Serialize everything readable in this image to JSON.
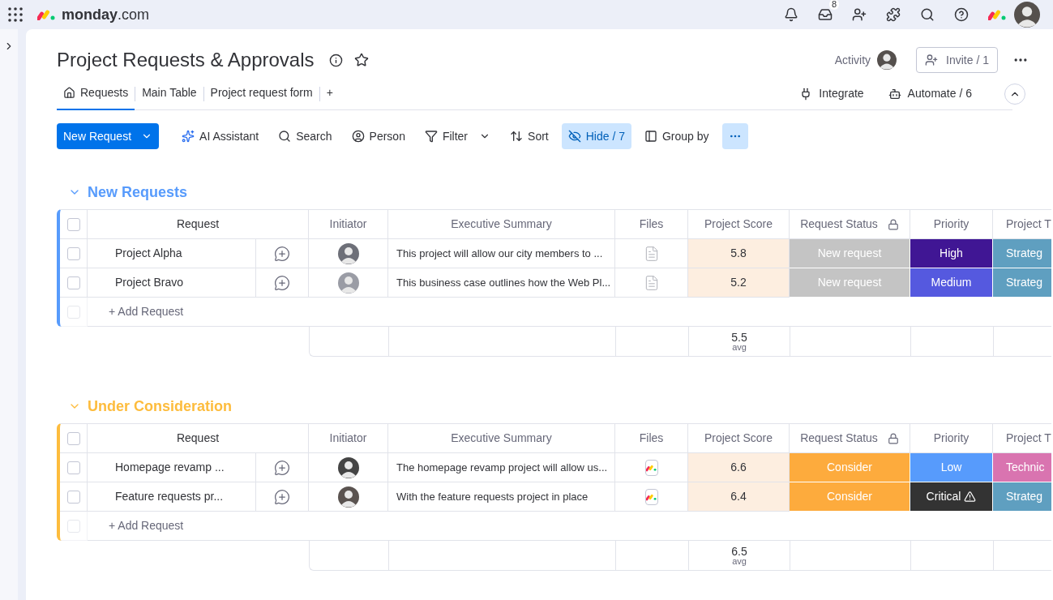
{
  "top_bar": {
    "brand": "monday",
    "brand_suffix": ".com",
    "inbox_badge": "8"
  },
  "board": {
    "title": "Project Requests & Approvals",
    "activity_label": "Activity",
    "invite_label": "Invite / 1"
  },
  "tabs": [
    {
      "label": "Requests",
      "selected": true
    },
    {
      "label": "Main Table",
      "selected": false
    },
    {
      "label": "Project request form",
      "selected": false
    },
    {
      "label": "+",
      "selected": false
    }
  ],
  "board_actions": [
    {
      "label": "Integrate"
    },
    {
      "label": "Automate / 6"
    }
  ],
  "toolbar": [
    {
      "label": "New Request",
      "kind": "primary"
    },
    {
      "label": "AI Assistant",
      "kind": "ai",
      "active": false
    },
    {
      "label": "Search",
      "kind": "search",
      "active": false
    },
    {
      "label": "Person",
      "kind": "person",
      "active": false
    },
    {
      "label": "Filter",
      "kind": "filter",
      "active": false
    },
    {
      "label": "Sort",
      "kind": "sort",
      "active": false
    },
    {
      "label": "Hide / 7",
      "kind": "hide",
      "active": true
    },
    {
      "label": "Group by",
      "kind": "group",
      "active": false
    },
    {
      "kind": "more",
      "active": true
    }
  ],
  "groups": [
    {
      "title": "New Requests",
      "color": "#579bfc",
      "columns": [
        "Request",
        "Initiator",
        "Executive Summary",
        "Files",
        "Project Score",
        "Request Status",
        "Priority",
        "Project T"
      ],
      "rows": [
        {
          "checked": false,
          "name": "Project Alpha",
          "summary": "This project will allow our city members to ...",
          "file": {
            "kind": "doc"
          },
          "score": "5.8",
          "status": {
            "label": "New request",
            "color": "#c4c4c4"
          },
          "priority": {
            "label": "High",
            "color": "#401694",
            "warning": false
          },
          "type": {
            "label": "Strateg",
            "color": "#5f9fc0"
          }
        },
        {
          "checked": false,
          "name": "Project Bravo",
          "summary": "This business case outlines how the Web Pl...",
          "file": {
            "kind": "doc"
          },
          "score": "5.2",
          "status": {
            "label": "New request",
            "color": "#c4c4c4"
          },
          "priority": {
            "label": "Medium",
            "color": "#5559df",
            "warning": false
          },
          "type": {
            "label": "Strateg",
            "color": "#5f9fc0"
          }
        }
      ],
      "add_row": {
        "label": "+ Add Request",
        "checked": false
      },
      "summary": {
        "value": "5.5",
        "label": "avg"
      }
    },
    {
      "title": "Under Consideration",
      "color": "#fdbc3d",
      "columns": [
        "Request",
        "Initiator",
        "Executive Summary",
        "Files",
        "Project Score",
        "Request Status",
        "Priority",
        "Project T"
      ],
      "rows": [
        {
          "checked": false,
          "name": "Homepage revamp ...",
          "summary": "The homepage revamp project will allow us...",
          "file": {
            "kind": "monday"
          },
          "score": "6.6",
          "status": {
            "label": "Consider",
            "color": "#fdab3d"
          },
          "priority": {
            "label": "Low",
            "color": "#579bfc",
            "warning": false
          },
          "type": {
            "label": "Technic",
            "color": "#d974b0"
          }
        },
        {
          "checked": false,
          "name": "Feature requests pr...",
          "summary": "With the feature requests project in place",
          "file": {
            "kind": "monday"
          },
          "score": "6.4",
          "status": {
            "label": "Consider",
            "color": "#fdab3d"
          },
          "priority": {
            "label": "Critical",
            "color": "#333333",
            "warning": true
          },
          "type": {
            "label": "Strateg",
            "color": "#5f9fc0"
          }
        }
      ],
      "add_row": {
        "label": "+ Add Request",
        "checked": false
      },
      "summary": {
        "value": "6.5",
        "label": "avg"
      }
    }
  ]
}
